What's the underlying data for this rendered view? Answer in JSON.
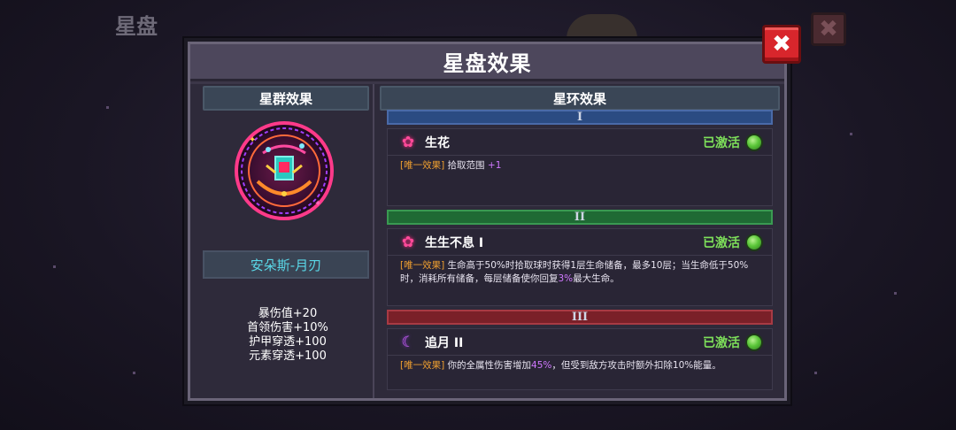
{
  "background": {
    "title": "星盘",
    "close_symbol": "✖"
  },
  "modal": {
    "title": "星盘效果",
    "close_symbol": "✖"
  },
  "left": {
    "header": "星群效果",
    "constellation_name": "安朵斯-月刃",
    "stats": [
      "暴伤值+20",
      "首领伤害+10%",
      "护甲穿透+100",
      "元素穿透+100"
    ]
  },
  "right": {
    "header": "星环效果",
    "tiers": [
      {
        "numeral": "I",
        "effect_name": "生花",
        "icon": "flower-icon",
        "status": "已激活",
        "tag": "[唯一效果]",
        "desc_pre": "拾取范围 ",
        "desc_hl": "+1",
        "desc_post": "",
        "desc_hl2": "",
        "desc_post2": ""
      },
      {
        "numeral": "II",
        "effect_name": "生生不息 I",
        "icon": "flower-icon",
        "status": "已激活",
        "tag": "[唯一效果]",
        "desc_pre": "生命高于50%时拾取球时获得1层生命储备，最多10层；当生命低于50%时，消耗所有储备，每层储备使你回复",
        "desc_hl": "3%",
        "desc_post": "最大生命。",
        "desc_hl2": "",
        "desc_post2": ""
      },
      {
        "numeral": "III",
        "effect_name": "追月 II",
        "icon": "moon-icon",
        "status": "已激活",
        "tag": "[唯一效果]",
        "desc_pre": "你的全属性伤害增加",
        "desc_hl": "45%",
        "desc_post": "，但受到敌方攻击时额外扣除10%能量。",
        "desc_hl2": "",
        "desc_post2": ""
      }
    ]
  },
  "colors": {
    "tier1": "#2b4b82",
    "tier2": "#1f6a34",
    "tier3": "#7a2028",
    "active_green": "#7ee05a",
    "tag_orange": "#f0a030",
    "highlight_purple": "#d078ff",
    "name_cyan": "#5ad8e8"
  }
}
